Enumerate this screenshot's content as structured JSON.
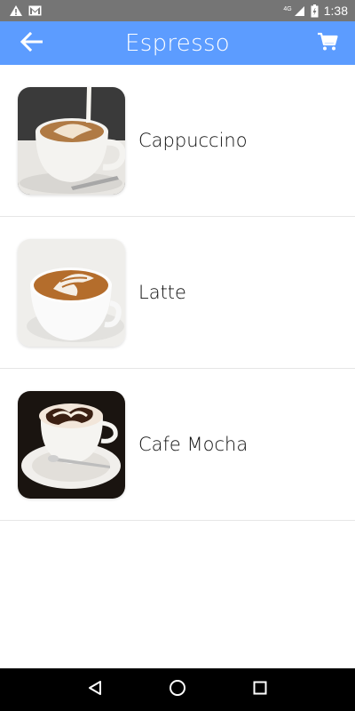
{
  "status_bar": {
    "time": "1:38",
    "network": "4G",
    "icons": [
      "warning-icon",
      "gmail-icon",
      "signal-icon",
      "battery-icon"
    ]
  },
  "app_bar": {
    "title": "Espresso",
    "back_icon": "arrow-back-icon",
    "cart_icon": "shopping-cart-icon",
    "background": "#5c9cff"
  },
  "items": [
    {
      "label": "Cappuccino",
      "image": "cappuccino-image"
    },
    {
      "label": "Latte",
      "image": "latte-image"
    },
    {
      "label": "Cafe Mocha",
      "image": "cafe-mocha-image"
    }
  ],
  "nav_bar": {
    "icons": [
      "nav-back-icon",
      "nav-home-icon",
      "nav-recents-icon"
    ]
  }
}
